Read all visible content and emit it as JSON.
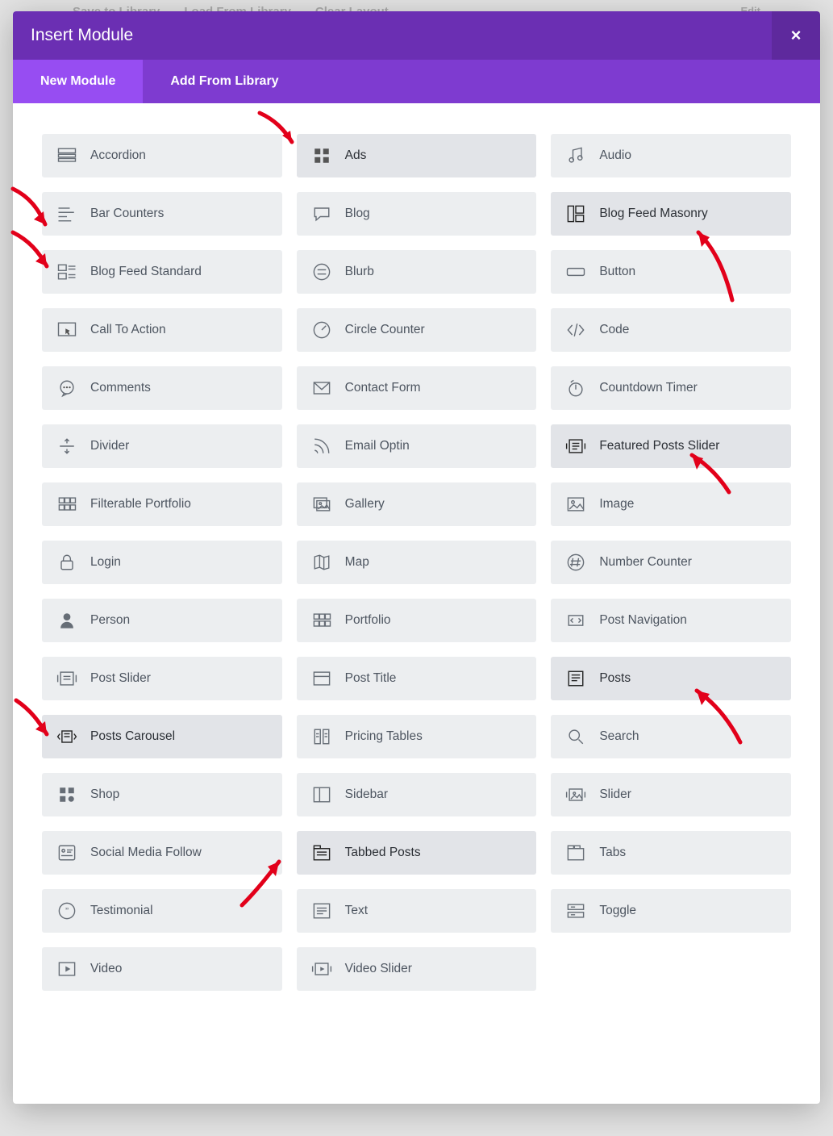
{
  "backdrop": {
    "save": "Save to Library",
    "load": "Load From Library",
    "clear": "Clear Layout",
    "edit": "Edit"
  },
  "modal": {
    "title": "Insert Module",
    "close": "×"
  },
  "tabs": {
    "new_module": "New Module",
    "add_from_library": "Add From Library"
  },
  "modules": [
    {
      "id": "accordion",
      "label": "Accordion",
      "icon": "accordion",
      "hover": false
    },
    {
      "id": "ads",
      "label": "Ads",
      "icon": "grid4",
      "hover": true
    },
    {
      "id": "audio",
      "label": "Audio",
      "icon": "music",
      "hover": false
    },
    {
      "id": "bar-counters",
      "label": "Bar Counters",
      "icon": "bars",
      "hover": false
    },
    {
      "id": "blog",
      "label": "Blog",
      "icon": "chat",
      "hover": false
    },
    {
      "id": "blog-feed-masonry",
      "label": "Blog Feed Masonry",
      "icon": "masonry",
      "hover": true
    },
    {
      "id": "blog-feed-standard",
      "label": "Blog Feed Standard",
      "icon": "feed",
      "hover": false
    },
    {
      "id": "blurb",
      "label": "Blurb",
      "icon": "circle-eq",
      "hover": false
    },
    {
      "id": "button",
      "label": "Button",
      "icon": "button",
      "hover": false
    },
    {
      "id": "call-to-action",
      "label": "Call To Action",
      "icon": "cta",
      "hover": false
    },
    {
      "id": "circle-counter",
      "label": "Circle Counter",
      "icon": "gauge",
      "hover": false
    },
    {
      "id": "code",
      "label": "Code",
      "icon": "code",
      "hover": false
    },
    {
      "id": "comments",
      "label": "Comments",
      "icon": "comments",
      "hover": false
    },
    {
      "id": "contact-form",
      "label": "Contact Form",
      "icon": "mail",
      "hover": false
    },
    {
      "id": "countdown-timer",
      "label": "Countdown Timer",
      "icon": "timer",
      "hover": false
    },
    {
      "id": "divider",
      "label": "Divider",
      "icon": "divider",
      "hover": false
    },
    {
      "id": "email-optin",
      "label": "Email Optin",
      "icon": "rss",
      "hover": false
    },
    {
      "id": "featured-posts-slider",
      "label": "Featured Posts Slider",
      "icon": "slider-post",
      "hover": true
    },
    {
      "id": "filterable-portfolio",
      "label": "Filterable Portfolio",
      "icon": "grid6",
      "hover": false
    },
    {
      "id": "gallery",
      "label": "Gallery",
      "icon": "gallery",
      "hover": false
    },
    {
      "id": "image",
      "label": "Image",
      "icon": "picture",
      "hover": false
    },
    {
      "id": "login",
      "label": "Login",
      "icon": "lock",
      "hover": false
    },
    {
      "id": "map",
      "label": "Map",
      "icon": "map",
      "hover": false
    },
    {
      "id": "number-counter",
      "label": "Number Counter",
      "icon": "hash",
      "hover": false
    },
    {
      "id": "person",
      "label": "Person",
      "icon": "person",
      "hover": false
    },
    {
      "id": "portfolio",
      "label": "Portfolio",
      "icon": "grid6b",
      "hover": false
    },
    {
      "id": "post-navigation",
      "label": "Post Navigation",
      "icon": "nav",
      "hover": false
    },
    {
      "id": "post-slider",
      "label": "Post Slider",
      "icon": "post-slider",
      "hover": false
    },
    {
      "id": "post-title",
      "label": "Post Title",
      "icon": "title",
      "hover": false
    },
    {
      "id": "posts",
      "label": "Posts",
      "icon": "posts",
      "hover": true
    },
    {
      "id": "posts-carousel",
      "label": "Posts Carousel",
      "icon": "carousel",
      "hover": true
    },
    {
      "id": "pricing-tables",
      "label": "Pricing Tables",
      "icon": "pricing",
      "hover": false
    },
    {
      "id": "search",
      "label": "Search",
      "icon": "search",
      "hover": false
    },
    {
      "id": "shop",
      "label": "Shop",
      "icon": "shop",
      "hover": false
    },
    {
      "id": "sidebar",
      "label": "Sidebar",
      "icon": "sidebar",
      "hover": false
    },
    {
      "id": "slider",
      "label": "Slider",
      "icon": "slider",
      "hover": false
    },
    {
      "id": "social-media-follow",
      "label": "Social Media Follow",
      "icon": "social",
      "hover": false
    },
    {
      "id": "tabbed-posts",
      "label": "Tabbed Posts",
      "icon": "tabbed",
      "hover": true
    },
    {
      "id": "tabs",
      "label": "Tabs",
      "icon": "tabs",
      "hover": false
    },
    {
      "id": "testimonial",
      "label": "Testimonial",
      "icon": "quote",
      "hover": false
    },
    {
      "id": "text",
      "label": "Text",
      "icon": "text",
      "hover": false
    },
    {
      "id": "toggle",
      "label": "Toggle",
      "icon": "toggle",
      "hover": false
    },
    {
      "id": "video",
      "label": "Video",
      "icon": "video",
      "hover": false
    },
    {
      "id": "video-slider",
      "label": "Video Slider",
      "icon": "video-slider",
      "hover": false
    }
  ]
}
